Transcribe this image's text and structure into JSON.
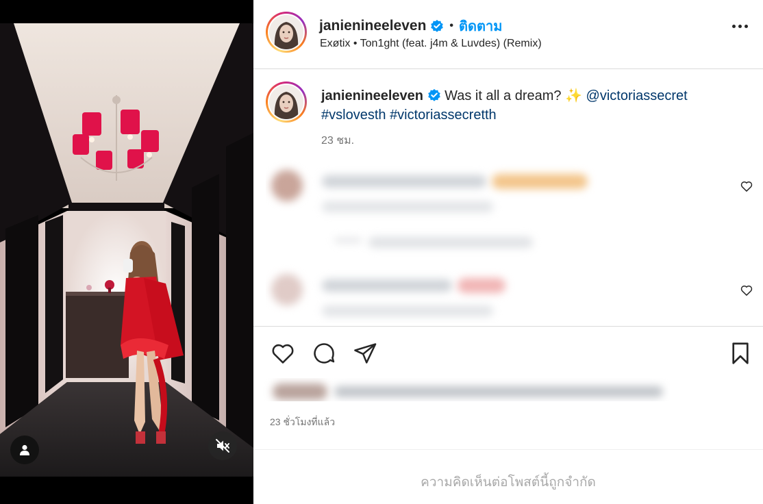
{
  "post": {
    "username": "janienineeleven",
    "verified": true,
    "follow_label": "ติดตาม",
    "audio": "Exøtix • Ton1ght (feat. j4m & Luvdes) (Remix)",
    "caption": {
      "username": "janienineeleven",
      "text": "Was it all a dream? ✨",
      "mention": "@victoriassecret",
      "hashtag1": "#vslovesth",
      "hashtag2": "#victoriassecretth",
      "time": "23 ชม."
    },
    "time_ago": "23 ชั่วโมงที่แล้ว",
    "comments_limited": "ความคิดเห็นต่อโพสต์นี้ถูกจำกัด"
  },
  "icons": {
    "verified": "verified-badge-icon",
    "more": "more-options-icon",
    "like": "heart-icon",
    "comment": "comment-icon",
    "share": "share-icon",
    "save": "bookmark-icon",
    "tag": "user-tag-icon",
    "mute": "speaker-muted-icon"
  },
  "colors": {
    "accent": "#0095f6",
    "link": "#00376b",
    "secondary_text": "#737373",
    "muted_text": "#a8a8a8",
    "verified": "#0095f6"
  }
}
